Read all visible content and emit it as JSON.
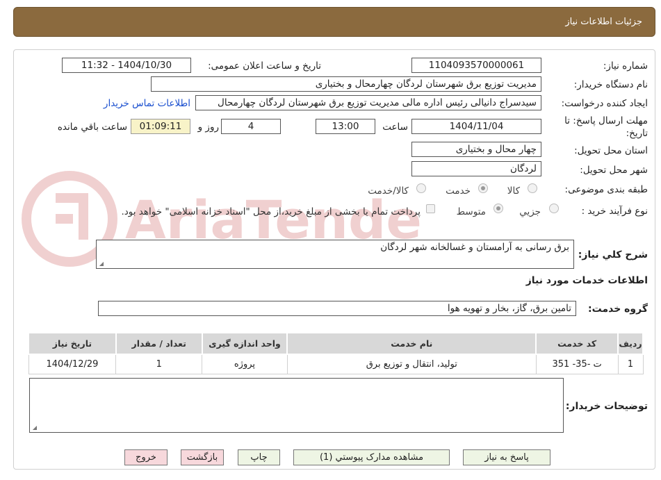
{
  "header": {
    "title": "جزئیات اطلاعات نیاز"
  },
  "fields": {
    "need_number_label": "شماره نیاز:",
    "need_number": "1104093570000061",
    "announce_label": "تاریخ و ساعت اعلان عمومی:",
    "announce_value": "1404/10/30 - 11:32",
    "buyer_label": "نام دستگاه خریدار:",
    "buyer_value": "مدیریت توزیع برق شهرستان لردگان چهارمحال و بختیاری",
    "creator_label": "ایجاد کننده درخواست:",
    "creator_value": "سیدسراج دانیالی رئیس اداره مالی مدیریت توزیع برق شهرستان لردگان چهارمحال",
    "contact_link": "اطلاعات تماس خریدار",
    "deadline_label_1": "مهلت ارسال پاسخ: تا",
    "deadline_label_2": "تاریخ:",
    "deadline_date": "1404/11/04",
    "hour_label": "ساعت",
    "deadline_time": "13:00",
    "days_value": "4",
    "days_label": "روز و",
    "remaining_time": "01:09:11",
    "remaining_label": "ساعت باقي مانده",
    "province_label": "استان محل تحویل:",
    "province_value": "چهار محال و بختیاری",
    "city_label": "شهر محل تحویل:",
    "city_value": "لردگان",
    "category_label": "طبقه بندی موضوعی:",
    "category_options": [
      "کالا",
      "خدمت",
      "کالا/خدمت"
    ],
    "category_selected": "خدمت",
    "process_label": "نوع فرآیند خرید :",
    "process_options": [
      "جزیي",
      "متوسط"
    ],
    "process_selected": "متوسط",
    "payment_note": "پرداخت تمام یا بخشی از مبلغ خرید،از محل \"اسناد خزانه اسلامی\" خواهد بود."
  },
  "summary": {
    "label": "شرح کلي نیاز:",
    "value": "برق رسانی به آرامستان و غسالخانه شهر لردگان"
  },
  "services": {
    "section_title": "اطلاعات خدمات مورد نیاز",
    "group_label": "گروه خدمت:",
    "group_value": "تامین برق، گاز، بخار و تهویه هوا",
    "table": {
      "headers": [
        "ردیف",
        "کد خدمت",
        "نام خدمت",
        "واحد اندازه گیری",
        "تعداد / مقدار",
        "تاریخ نیاز"
      ],
      "rows": [
        [
          "1",
          "ت -35- 351",
          "تولید، انتقال و توزیع برق",
          "پروژه",
          "1",
          "1404/12/29"
        ]
      ]
    }
  },
  "buyer_notes": {
    "label": "توضیحات خریدار:",
    "value": ""
  },
  "buttons": {
    "reply": "پاسخ به نیاز",
    "docs": "مشاهده مدارک پیوستي (1)",
    "print": "چاپ",
    "back": "بازگشت",
    "exit": "خروج"
  },
  "watermark": {
    "text": "AriaTender.neT"
  }
}
